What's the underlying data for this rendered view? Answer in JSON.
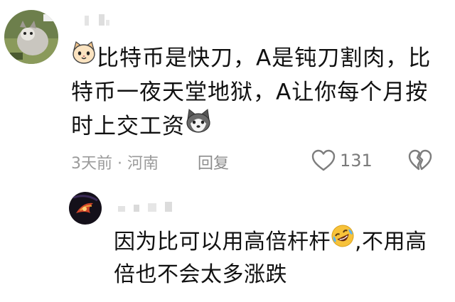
{
  "comment": {
    "text_line1": "比特币是快刀，A是钝刀割肉，比",
    "text_line2": "特币一夜天堂地狱，A让你每个月按",
    "text_line3": "时上交工资",
    "time": "3天前",
    "dot": "·",
    "location": "河南",
    "reply_label": "回复",
    "like_count": "131",
    "emoji_start": "cat-face-icon",
    "emoji_end": "husky-face-icon"
  },
  "reply": {
    "text_part1": "因为比可以用高倍杆杆",
    "text_part2": ",不用高",
    "text_line2": "倍也不会太多涨跌",
    "emoji": "rofl-face-icon"
  },
  "colors": {
    "meta_gray": "#9a9a9a",
    "text": "#111111",
    "emoji_yellow": "#f7c23a"
  }
}
